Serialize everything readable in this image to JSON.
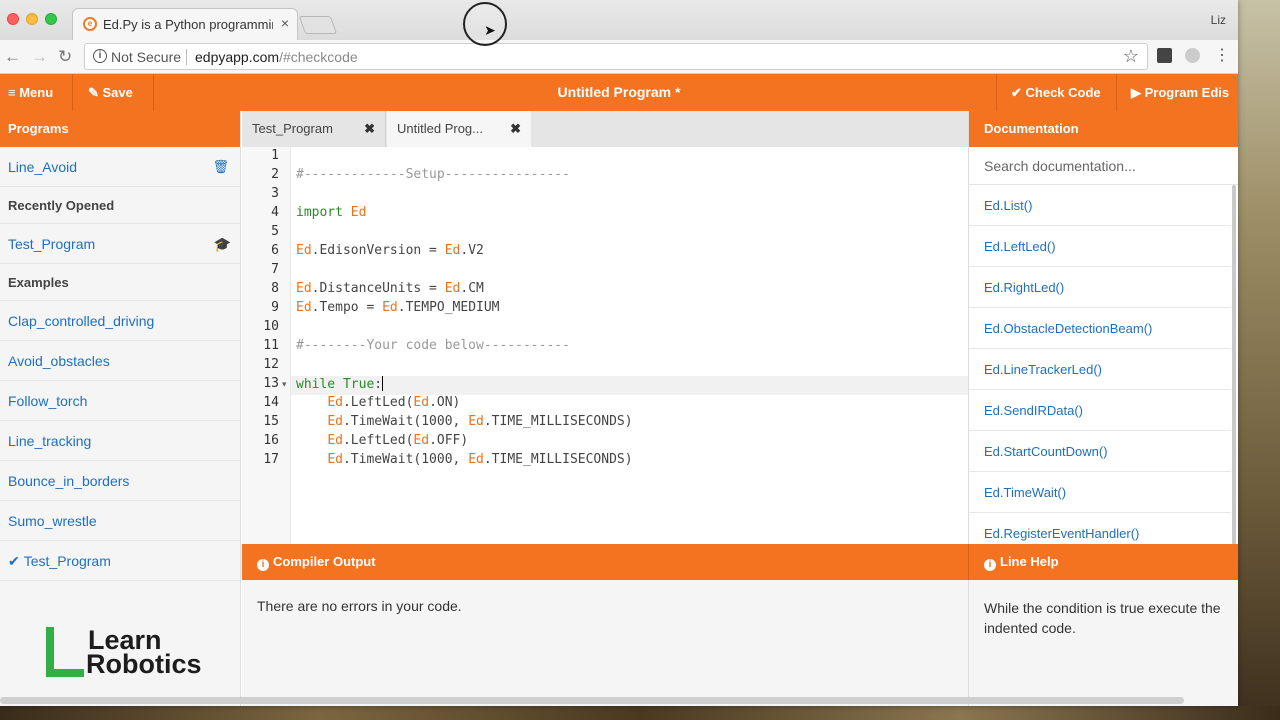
{
  "browser": {
    "tab_title": "Ed.Py is a Python programming",
    "tab_close": "×",
    "profile": "Liz",
    "security_label": "Not Secure",
    "url_host": "edpyapp.com",
    "url_path": "/#checkcode"
  },
  "header": {
    "menu_label": "≡ Menu",
    "save_label": "✎ Save",
    "title": "Untitled Program *",
    "check_label": "✔ Check Code",
    "program_label": "▶ Program Edis"
  },
  "sidebar": {
    "title": "Programs",
    "programs": [
      {
        "label": "Line_Avoid"
      }
    ],
    "recent_title": "Recently Opened",
    "recent": [
      {
        "label": "Test_Program"
      }
    ],
    "examples_title": "Examples",
    "examples": [
      {
        "label": "Clap_controlled_driving"
      },
      {
        "label": "Avoid_obstacles"
      },
      {
        "label": "Follow_torch"
      },
      {
        "label": "Line_tracking"
      },
      {
        "label": "Bounce_in_borders"
      },
      {
        "label": "Sumo_wrestle"
      },
      {
        "label": "Test_Program",
        "checked": true
      }
    ]
  },
  "logo": {
    "line1": "Learn",
    "line2": "Robotics"
  },
  "editor": {
    "tabs": [
      {
        "label": "Test_Program",
        "close": "✖"
      },
      {
        "label": "Untitled Prog...",
        "close": "✖"
      }
    ],
    "active_line": 13,
    "lines": [
      "",
      "#-------------Setup----------------",
      "",
      "import Ed",
      "",
      "Ed.EdisonVersion = Ed.V2",
      "",
      "Ed.DistanceUnits = Ed.CM",
      "Ed.Tempo = Ed.TEMPO_MEDIUM",
      "",
      "#--------Your code below-----------",
      "",
      "while True:",
      "    Ed.LeftLed(Ed.ON)",
      "    Ed.TimeWait(1000, Ed.TIME_MILLISECONDS)",
      "    Ed.LeftLed(Ed.OFF)",
      "    Ed.TimeWait(1000, Ed.TIME_MILLISECONDS)"
    ]
  },
  "docs": {
    "title": "Documentation",
    "search_placeholder": "Search documentation...",
    "items": [
      "Ed.List()",
      "Ed.LeftLed()",
      "Ed.RightLed()",
      "Ed.ObstacleDetectionBeam()",
      "Ed.LineTrackerLed()",
      "Ed.SendIRData()",
      "Ed.StartCountDown()",
      "Ed.TimeWait()",
      "Ed.RegisterEventHandler()"
    ]
  },
  "compiler": {
    "title": "Compiler Output",
    "message": "There are no errors in your code."
  },
  "line_help": {
    "title": "Line Help",
    "message": "While the condition is true execute the indented code."
  },
  "colors": {
    "accent": "#f47321",
    "link": "#1f6fbf",
    "keyword": "#2a8a2a",
    "ed_token": "#e8731e"
  }
}
